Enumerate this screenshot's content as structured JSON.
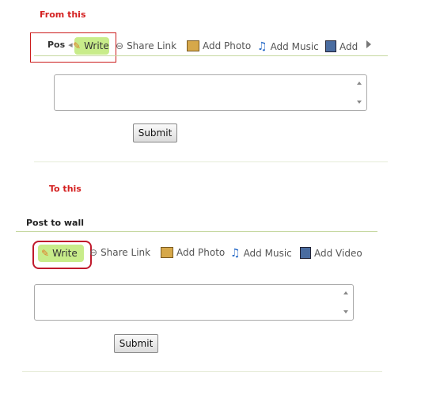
{
  "labels": {
    "from": "From this",
    "to": "To this"
  },
  "before": {
    "post_fragment": "Pos",
    "write": "Write",
    "share": "Share Link",
    "photo": "Add Photo",
    "music": "Add Music",
    "add": "Add",
    "submit": "Submit"
  },
  "after": {
    "title": "Post to wall",
    "write": "Write",
    "share": "Share Link",
    "photo": "Add Photo",
    "music": "Add Music",
    "video": "Add Video",
    "submit": "Submit"
  },
  "icons": [
    "pencil-icon",
    "link-icon",
    "photo-icon",
    "music-note-icon",
    "film-icon",
    "arrow-right-icon"
  ],
  "colors": {
    "accent_red": "#cc1d1d",
    "write_green": "#c8ec8a",
    "divider_green": "#c6d8a0"
  }
}
